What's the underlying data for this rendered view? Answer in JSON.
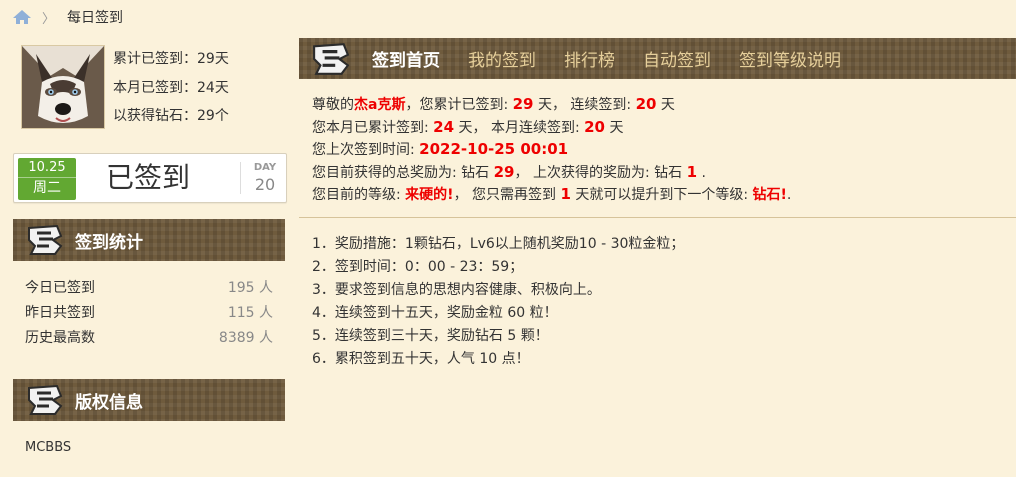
{
  "breadcrumb": {
    "home_icon": "home-icon",
    "separator": "〉",
    "current": "每日签到"
  },
  "user": {
    "avatar_icon": "husky-avatar",
    "stats": [
      "累计已签到：29天",
      "本月已签到：24天",
      "以获得钻石：29个"
    ]
  },
  "sign_card": {
    "date": "10.25",
    "weekday": "周二",
    "status": "已签到",
    "day_label": "DAY",
    "day_number": "20"
  },
  "stats_section": {
    "title": "签到统计",
    "rows": [
      {
        "label": "今日已签到",
        "value": "195 人"
      },
      {
        "label": "昨日共签到",
        "value": "115 人"
      },
      {
        "label": "历史最高数",
        "value": "8389 人"
      }
    ]
  },
  "copyright_section": {
    "title": "版权信息",
    "text": "MCBBS"
  },
  "nav": {
    "tabs": [
      "签到首页",
      "我的签到",
      "排行榜",
      "自动签到",
      "签到等级说明"
    ]
  },
  "info": {
    "l1": {
      "a": "尊敬的",
      "name": "杰a克斯",
      "b": "，您累计已签到: ",
      "total": "29",
      "c": " 天， 连续签到: ",
      "streak": "20",
      "d": " 天"
    },
    "l2": {
      "a": "您本月已累计签到: ",
      "month": "24",
      "b": " 天， 本月连续签到: ",
      "month_streak": "20",
      "c": " 天"
    },
    "l3": {
      "a": "您上次签到时间: ",
      "time": "2022-10-25 00:01"
    },
    "l4": {
      "a": "您目前获得的总奖励为: 钻石 ",
      "total_reward": "29",
      "b": "， 上次获得的奖励为: 钻石 ",
      "last_reward": "1",
      "c": " ."
    },
    "l5": {
      "a": "您目前的等级: ",
      "level": "来硬的!",
      "b": "， 您只需再签到 ",
      "days_needed": "1",
      "c": " 天就可以提升到下一个等级: ",
      "next_level": "钻石!",
      "d": "."
    }
  },
  "rules": [
    "1．奖励措施：1颗钻石，Lv6以上随机奖励10 - 30粒金粒；",
    "2．签到时间：0：00 - 23：59；",
    "3．要求签到信息的思想内容健康、积极向上。",
    "4．连续签到十五天，奖励金粒 60 粒！",
    "5．连续签到三十天，奖励钻石 5 颗！",
    "6．累积签到五十天，人气 10 点！"
  ],
  "colors": {
    "background": "#fbf2db",
    "header": "#6f5b3d",
    "highlight": "#e00000",
    "green": "#62a832"
  }
}
